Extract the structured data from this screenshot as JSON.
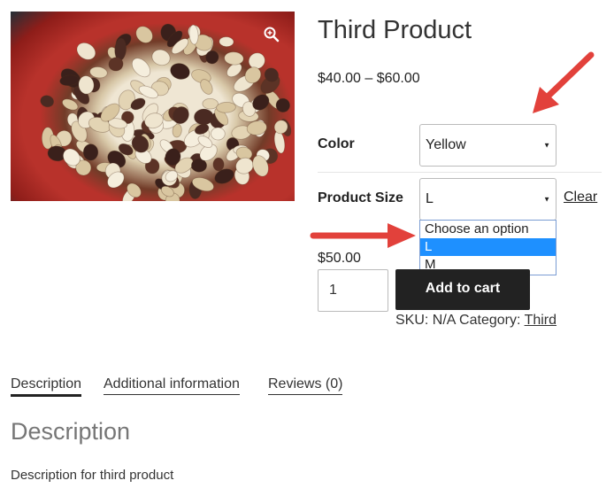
{
  "product": {
    "title": "Third Product",
    "price_range": "$40.00 – $60.00",
    "variation_price": "$50.00",
    "quantity": "1",
    "add_to_cart_label": "Add to cart"
  },
  "variations": {
    "color": {
      "label": "Color",
      "value": "Yellow"
    },
    "size": {
      "label": "Product Size",
      "value": "L",
      "clear_label": "Clear",
      "options": [
        "Choose an option",
        "L",
        "M"
      ],
      "selected_option": "L"
    }
  },
  "meta": {
    "sku_label": "SKU:",
    "sku_value": "N/A",
    "category_label": "Category:",
    "category_value": "Third"
  },
  "tabs": [
    {
      "label": "Description",
      "active": true
    },
    {
      "label": "Additional information",
      "active": false
    },
    {
      "label": "Reviews (0)",
      "active": false
    }
  ],
  "description": {
    "heading": "Description",
    "text": "Description for third product"
  },
  "colors": {
    "arrow": "#e2413b",
    "dropdown_highlight": "#1e90ff",
    "button_bg": "#222222"
  },
  "icons": {
    "zoom": "magnifier-plus-icon",
    "caret": "caret-down-icon"
  }
}
